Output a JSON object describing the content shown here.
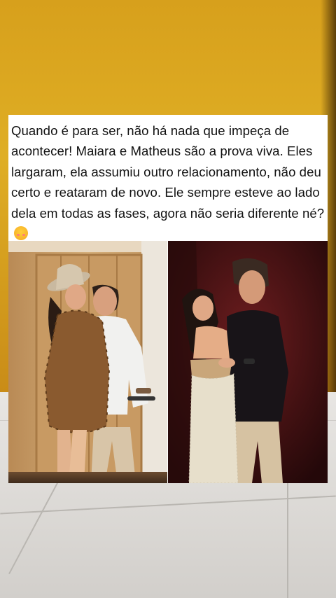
{
  "post": {
    "caption": "Quando é para ser, não há nada que impeça de acontecer! Maiara e Matheus são a prova viva. Eles largaram, ela assumiu outro relacionamento, não deu certo e reataram de novo. Ele sempre esteve ao lado dela em todas as fases, agora não seria diferente né?",
    "emoji_icon": "smiling-face-with-hearts-icon"
  },
  "colors": {
    "background_top": "#d7a01c",
    "floor": "#e2e0dc",
    "card": "#ffffff",
    "text": "#121212",
    "right_photo_backdrop": "#4a1416"
  }
}
